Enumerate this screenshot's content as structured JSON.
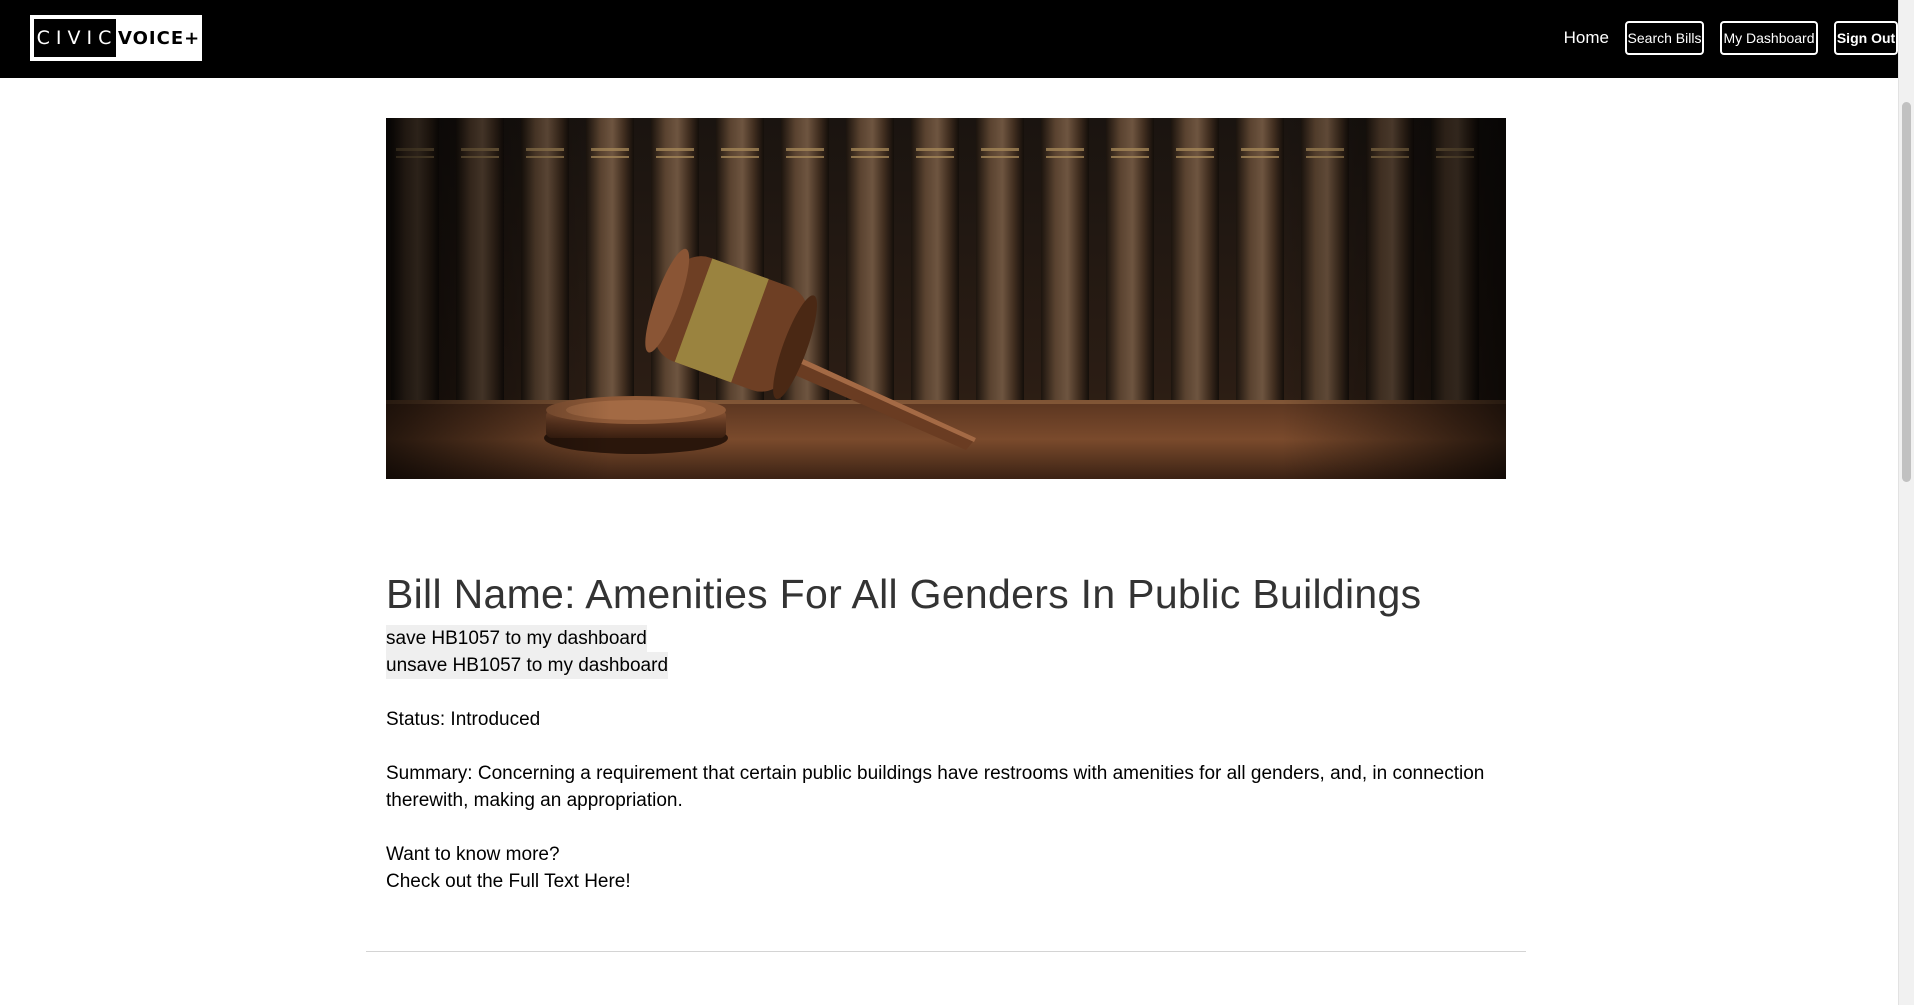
{
  "navbar": {
    "logo": {
      "part1": "CIVIC",
      "part2": "VOICE+"
    },
    "home_label": "Home",
    "search_label": "Search Bills",
    "dashboard_label": "My Dashboard",
    "signout_label": "Sign Out"
  },
  "bill": {
    "title": "Bill Name: Amenities For All Genders In Public Buildings",
    "save_label": "save HB1057 to my dashboard",
    "unsave_label": "unsave HB1057 to my dashboard",
    "status": "Status: Introduced",
    "summary": "Summary: Concerning a requirement that certain public buildings have restrooms with amenities for all genders, and, in connection therewith, making an appropriation.",
    "more_line1": "Want to know more?",
    "more_line2": "Check out the Full Text Here!"
  },
  "colors": {
    "navbar_bg": "#000000",
    "title_text": "#333333",
    "button_bg": "#efefef"
  }
}
